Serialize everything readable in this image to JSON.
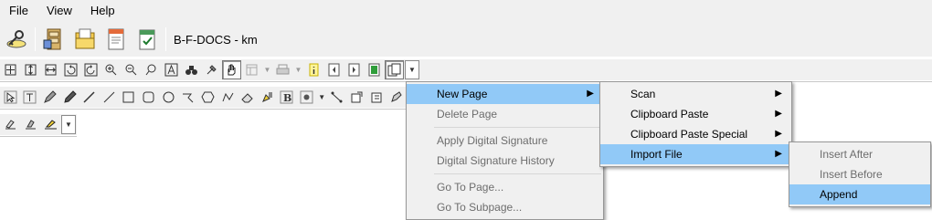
{
  "menubar": {
    "items": [
      "File",
      "View",
      "Help"
    ]
  },
  "toolbar": {
    "title": "B-F-DOCS - km",
    "big_icons": [
      "key-icon",
      "cabinet-icon",
      "folder-stack-icon",
      "document-icon",
      "document-check-icon"
    ]
  },
  "menus": {
    "main": {
      "new_page": "New Page",
      "delete_page": "Delete Page",
      "apply_sig": "Apply Digital Signature",
      "sig_history": "Digital Signature History",
      "go_to_page": "Go To Page...",
      "go_to_subpage": "Go To Subpage..."
    },
    "new_page_sub": {
      "scan": "Scan",
      "clip_paste": "Clipboard Paste",
      "clip_paste_special": "Clipboard Paste Special",
      "import_file": "Import File"
    },
    "import_sub": {
      "insert_after": "Insert After",
      "insert_before": "Insert Before",
      "append": "Append"
    }
  },
  "colors": {
    "highlight": "#91c9f7",
    "bar": "#f0f0f0",
    "disabled_text": "#6d6d6d"
  }
}
